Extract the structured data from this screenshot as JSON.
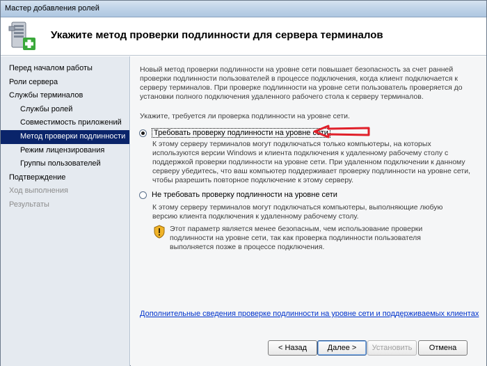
{
  "window": {
    "title": "Мастер добавления ролей"
  },
  "header": {
    "title": "Укажите метод проверки подлинности для сервера терминалов"
  },
  "sidebar": {
    "items": [
      {
        "label": "Перед началом работы",
        "state": "normal",
        "level": 0
      },
      {
        "label": "Роли сервера",
        "state": "normal",
        "level": 0
      },
      {
        "label": "Службы терминалов",
        "state": "normal",
        "level": 0
      },
      {
        "label": "Службы ролей",
        "state": "normal",
        "level": 1
      },
      {
        "label": "Совместимость приложений",
        "state": "normal",
        "level": 1
      },
      {
        "label": "Метод проверки подлинности",
        "state": "active",
        "level": 1
      },
      {
        "label": "Режим лицензирования",
        "state": "normal",
        "level": 1
      },
      {
        "label": "Группы пользователей",
        "state": "normal",
        "level": 1
      },
      {
        "label": "Подтверждение",
        "state": "normal",
        "level": 0
      },
      {
        "label": "Ход выполнения",
        "state": "disabled",
        "level": 0
      },
      {
        "label": "Результаты",
        "state": "disabled",
        "level": 0
      }
    ]
  },
  "main": {
    "intro": "Новый метод проверки подлинности на уровне сети повышает безопасность за счет ранней проверки подлинности пользователей в процессе подключения, когда клиент подключается к серверу терминалов. При проверке подлинности на уровне сети пользователь проверяется до установки полного подключения удаленного рабочего стола к серверу терминалов.",
    "question": "Укажите, требуется ли проверка подлинности на уровне сети.",
    "option1": {
      "label": "Требовать проверку подлинности на уровне сети",
      "selected": true,
      "description": "К этому серверу терминалов могут подключаться только компьютеры, на которых используются версии Windows и клиента подключения к удаленному рабочему столу с поддержкой проверки подлинности на уровне сети. При удаленном подключении к данному серверу убедитесь, что ваш компьютер поддерживает проверку подлинности на уровне сети, чтобы разрешить повторное подключение к этому серверу."
    },
    "option2": {
      "label": "Не требовать проверку подлинности на уровне сети",
      "selected": false,
      "description": "К этому серверу терминалов могут подключаться компьютеры, выполняющие любую версию клиента подключения к удаленному рабочему столу.",
      "warning": "Этот параметр является менее безопасным, чем использование проверки подлинности на уровне сети, так как проверка подлинности пользователя выполняется позже в процессе подключения."
    },
    "link": "Дополнительные сведения проверке подлинности на уровне сети и поддерживаемых клиентах"
  },
  "buttons": {
    "back": "< Назад",
    "next": "Далее >",
    "install": "Установить",
    "cancel": "Отмена"
  },
  "colors": {
    "active_item": "#0a246a",
    "link": "#0033cc",
    "annotation_arrow": "#e0202a"
  },
  "icons": {
    "header": "server-add-icon",
    "warning": "shield-warning-icon",
    "annotation": "red-arrow-icon"
  }
}
